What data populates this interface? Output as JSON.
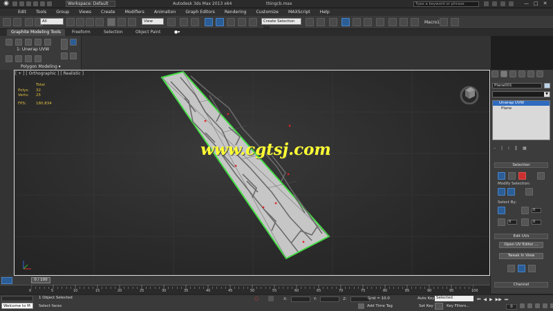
{
  "titlebar": {
    "workspace": "Workspace: Default",
    "app_title": "Autodesk 3ds Max 2013 x64",
    "file_name": "thingcb.max",
    "search_placeholder": "Type a keyword or phrase"
  },
  "menu": [
    "Edit",
    "Tools",
    "Group",
    "Views",
    "Create",
    "Modifiers",
    "Animation",
    "Graph Editors",
    "Rendering",
    "Customize",
    "MAXScript",
    "Help"
  ],
  "toolbar": {
    "selection_filter": "All",
    "ref_coord": "View",
    "named_selection": "Create Selection Set",
    "macro": "Macro1"
  },
  "ribbon": {
    "tabs": [
      "Graphite Modeling Tools",
      "Freeform",
      "Selection",
      "Object Paint"
    ],
    "modifier_label": "1: Unwrap UVW",
    "panel_label": "Polygon Modeling ▾"
  },
  "viewport": {
    "label": "[ + ] [ Orthographic ] [ Realistic ]",
    "stats": {
      "header": "Total",
      "polys_label": "Polys:",
      "polys": "32",
      "verts_label": "Verts:",
      "verts": "25",
      "fps_label": "FPS:",
      "fps": "180.834"
    },
    "watermark": "www.cgtsj.com"
  },
  "command_panel": {
    "object_name": "Plane001",
    "object_color": "#bcd3ea",
    "modifier_list": "",
    "stack": [
      "Unwrap UVW",
      "Plane"
    ],
    "selection_title": "Selection",
    "modify_selection_label": "Modify Selection:",
    "select_by_label": "Select By:",
    "edit_uvs_title": "Edit UVs",
    "open_uv_editor": "Open UV Editor ...",
    "tweak_in_view": "Tweak In View",
    "channel_title": "Channel",
    "num_value_1": "0",
    "num_value_2": "0"
  },
  "timeline": {
    "thumb": "0 / 100",
    "ticks": [
      "0",
      "5",
      "10",
      "15",
      "20",
      "25",
      "30",
      "35",
      "40",
      "45",
      "50",
      "55",
      "60",
      "65",
      "70",
      "75",
      "80",
      "85",
      "90",
      "95",
      "100"
    ]
  },
  "status": {
    "welcome": "Welcome to M",
    "selected": "1 Object Selected",
    "prompt": "Select faces",
    "x_label": "X:",
    "y_label": "Y:",
    "z_label": "Z:",
    "grid": "Grid = 10.0",
    "add_time_tag": "Add Time Tag",
    "auto_key": "Auto Key",
    "set_key": "Set Key",
    "key_mode": "Selected",
    "key_filters": "Key Filters...",
    "frame": "0"
  },
  "colors": {
    "mesh_fill": "#c9c9c9",
    "mesh_edge": "#44dd44",
    "accent_blue": "#2f6bbf"
  }
}
